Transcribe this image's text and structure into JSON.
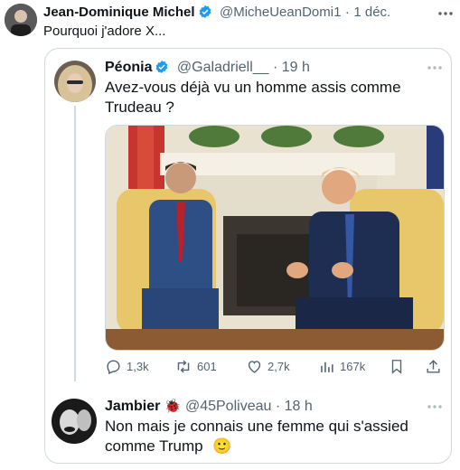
{
  "main": {
    "name": "Jean-Dominique Michel",
    "handle": "@MicheUeanDomi1",
    "time": "1 déc.",
    "text": "Pourquoi j'adore X..."
  },
  "quoted": {
    "name": "Péonia",
    "handle": "@Galadriell__",
    "time": "19 h",
    "text_line1": "Avez-vous déjà vu un homme assis comme",
    "text_line2": "Trudeau ?",
    "stats": {
      "replies": "1,3k",
      "retweets": "601",
      "likes": "2,7k",
      "views": "167k"
    }
  },
  "reply": {
    "name": "Jambier",
    "handle": "@45Poliveau",
    "time": "18 h",
    "text_line1": "Non mais je connais une femme qui s'assied",
    "text_line2": "comme Trump",
    "emoji": "🙂",
    "name_emoji": "🐞"
  },
  "separator": "·",
  "colors": {
    "verified": "#1d9bf0",
    "muted": "#536471",
    "border": "#cfd9de"
  }
}
